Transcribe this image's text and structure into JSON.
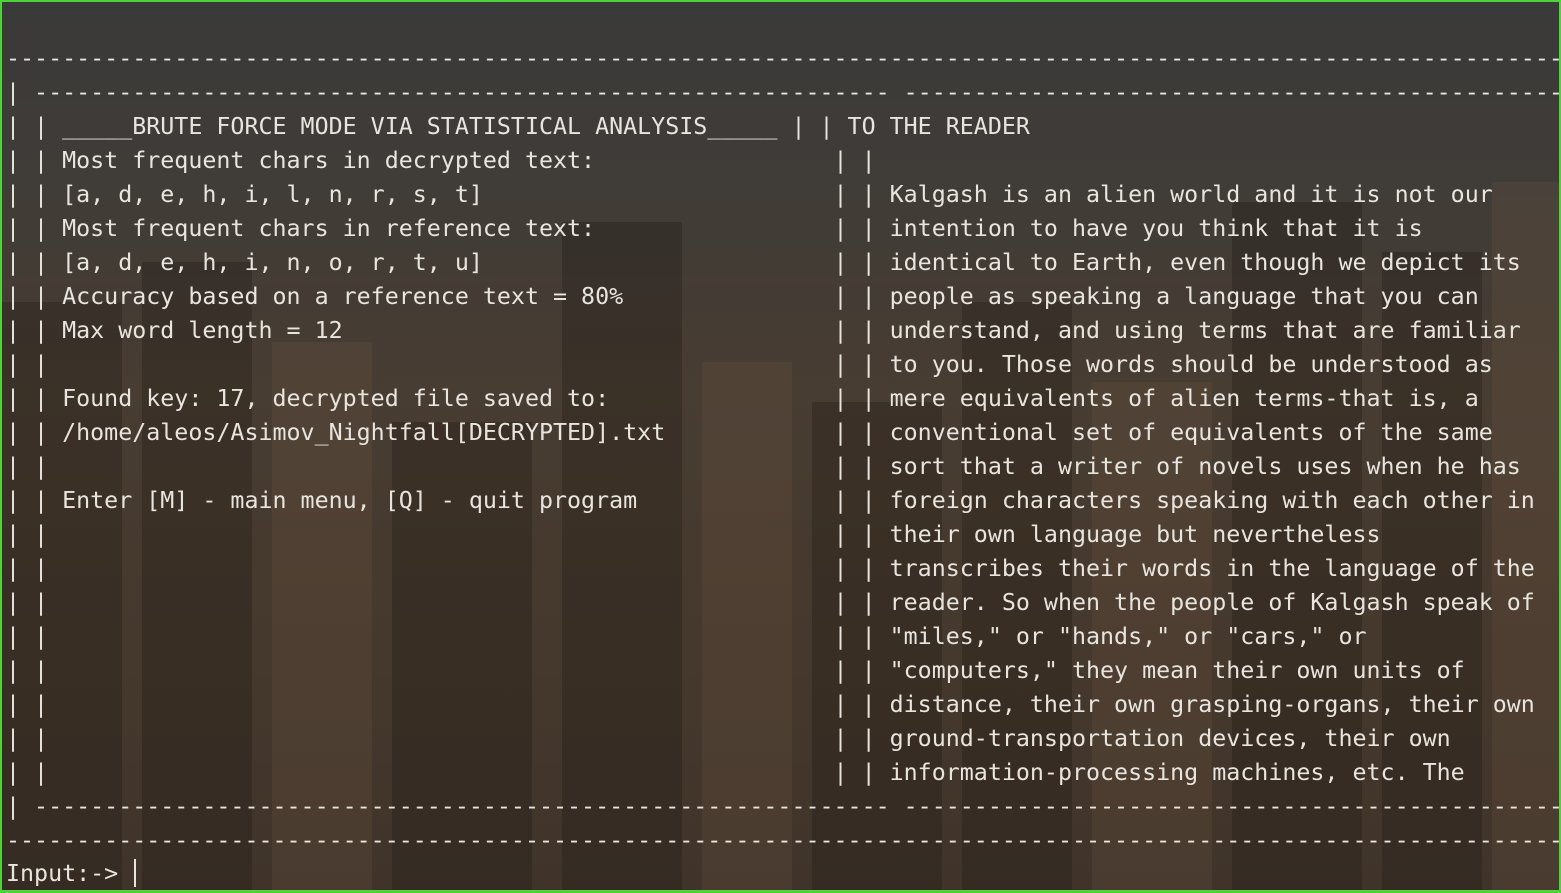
{
  "terminal": {
    "lines": [
      "---------------------------------------------------------------------------------------------------------------------------------",
      "| ------------------------------------------------------------- ----------------------------------------------------------- |",
      "| | _____BRUTE FORCE MODE VIA STATISTICAL ANALYSIS_____ | | TO THE READER                                       | |",
      "| | Most frequent chars in decrypted text:                 | |                                                     | |",
      "| | [a, d, e, h, i, l, n, r, s, t]                         | | Kalgash is an alien world and it is not our         | |",
      "| | Most frequent chars in reference text:                 | | intention to have you think that it is              | |",
      "| | [a, d, e, h, i, n, o, r, t, u]                         | | identical to Earth, even though we depict its      | |",
      "| | Accuracy based on a reference text = 80%               | | people as speaking a language that you can          | |",
      "| | Max word length = 12                                   | | understand, and using terms that are familiar      | |",
      "| |                                                        | | to you. Those words should be understood as         | |",
      "| | Found key: 17, decrypted file saved to:                | | mere equivalents of alien terms-that is, a          | |",
      "| | /home/aleos/Asimov_Nightfall[DECRYPTED].txt            | | conventional set of equivalents of the same         | |",
      "| |                                                        | | sort that a writer of novels uses when he has      | |",
      "| | Enter [M] - main menu, [Q] - quit program              | | foreign characters speaking with each other in     | |",
      "| |                                                        | | their own language but nevertheless                | |",
      "| |                                                        | | transcribes their words in the language of the     | |",
      "| |                                                        | | reader. So when the people of Kalgash speak of     | |",
      "| |                                                        | | \"miles,\" or \"hands,\" or \"cars,\" or                 | |",
      "| |                                                        | | \"computers,\" they mean their own units of          | |",
      "| |                                                        | | distance, their own grasping-organs, their own     | |",
      "| |                                                        | | ground-transportation devices, their own           | |",
      "| |                                                        | | information-processing machines, etc. The         | |",
      "| ------------------------------------------------------------- ----------------------------------------------------------- |",
      "---------------------------------------------------------------------------------------------------------------------------------"
    ],
    "prompt": "Input:-> "
  }
}
